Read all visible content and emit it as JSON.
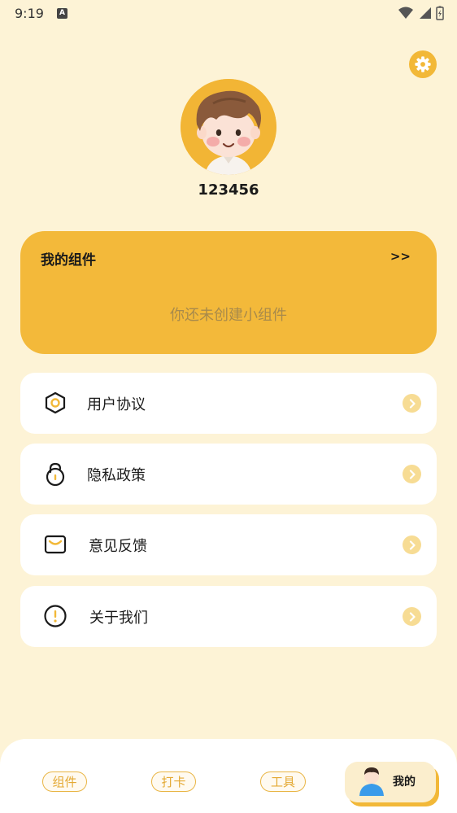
{
  "status_bar": {
    "time": "9:19",
    "badge": "A"
  },
  "profile": {
    "username": "123456",
    "accent_color": "#f2b838"
  },
  "widgets": {
    "title": "我的组件",
    "more": ">>",
    "empty_text": "你还未创建小组件"
  },
  "menu": [
    {
      "label": "用户协议",
      "icon": "hexagon-icon"
    },
    {
      "label": "隐私政策",
      "icon": "lock-icon"
    },
    {
      "label": "意见反馈",
      "icon": "mail-icon"
    },
    {
      "label": "关于我们",
      "icon": "info-icon"
    }
  ],
  "bottom_nav": {
    "tabs": [
      "组件",
      "打卡",
      "工具",
      "我的"
    ],
    "active": "我的"
  }
}
